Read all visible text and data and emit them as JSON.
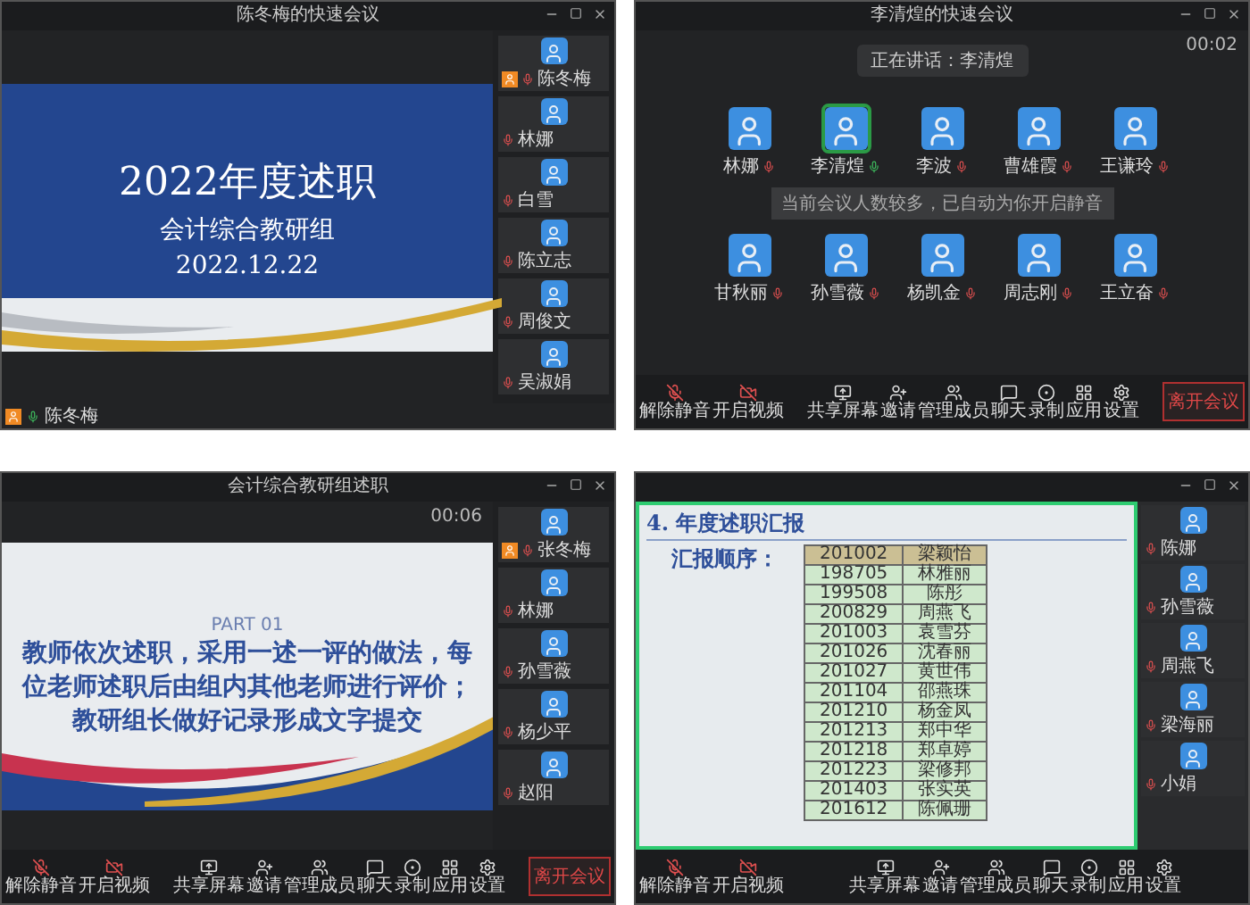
{
  "meetings": [
    {
      "kind": "slide",
      "title": "陈冬梅的快速会议",
      "slide": {
        "title": "2022年度述职",
        "subtitle": "会计综合教研组",
        "date": "2022.12.22"
      },
      "participants": [
        {
          "name": "陈冬梅",
          "host": true
        },
        {
          "name": "林娜",
          "host": false
        },
        {
          "name": "白雪",
          "host": false
        },
        {
          "name": "陈立志",
          "host": false
        },
        {
          "name": "周俊文",
          "host": false
        },
        {
          "name": "吴淑娟",
          "host": false
        }
      ],
      "speaker": "陈冬梅"
    },
    {
      "kind": "grid",
      "title": "李清煌的快速会议",
      "timer": "00:02",
      "notice": "正在讲话：李清煌",
      "tooltip": "当前会议人数较多，已自动为你开启静音",
      "people": [
        {
          "name": "林娜",
          "speaking": false
        },
        {
          "name": "李清煌",
          "speaking": true
        },
        {
          "name": "李波",
          "speaking": false
        },
        {
          "name": "曹雄霞",
          "speaking": false
        },
        {
          "name": "王谦玲",
          "speaking": false
        },
        {
          "name": "甘秋丽",
          "speaking": false
        },
        {
          "name": "孙雪薇",
          "speaking": false
        },
        {
          "name": "杨凯金",
          "speaking": false
        },
        {
          "name": "周志刚",
          "speaking": false
        },
        {
          "name": "王立奋",
          "speaking": false
        }
      ],
      "toolbar": [
        {
          "kind": "mic",
          "label": "解除静音"
        },
        {
          "kind": "video",
          "label": "开启视频"
        },
        {
          "kind": "share",
          "label": "共享屏幕"
        },
        {
          "kind": "invite",
          "label": "邀请"
        },
        {
          "kind": "members",
          "label": "管理成员"
        },
        {
          "kind": "chat",
          "label": "聊天"
        },
        {
          "kind": "record",
          "label": "录制"
        },
        {
          "kind": "apps",
          "label": "应用"
        },
        {
          "kind": "settings",
          "label": "设置"
        }
      ],
      "leave": "离开会议"
    },
    {
      "kind": "text_slide",
      "title": "会计综合教研组述职",
      "timer": "00:06",
      "slide": {
        "part": "PART 01",
        "lines": [
          "教师依次述职，采用一述一评的做法，每",
          "位老师述职后由组内其他老师进行评价；",
          "教研组长做好记录形成文字提交"
        ]
      },
      "participants": [
        {
          "name": "张冬梅",
          "host": true
        },
        {
          "name": "林娜",
          "host": false
        },
        {
          "name": "孙雪薇",
          "host": false
        },
        {
          "name": "杨少平",
          "host": false
        },
        {
          "name": "赵阳",
          "host": false
        }
      ],
      "toolbar": [
        {
          "kind": "mic",
          "label": "解除静音"
        },
        {
          "kind": "video",
          "label": "开启视频"
        },
        {
          "kind": "share",
          "label": "共享屏幕"
        },
        {
          "kind": "invite",
          "label": "邀请"
        },
        {
          "kind": "members",
          "label": "管理成员"
        },
        {
          "kind": "chat",
          "label": "聊天"
        },
        {
          "kind": "record",
          "label": "录制"
        },
        {
          "kind": "apps",
          "label": "应用"
        },
        {
          "kind": "settings",
          "label": "设置"
        }
      ],
      "leave": "离开会议"
    },
    {
      "kind": "table_slide",
      "slide": {
        "title": "4. 年度述职汇报",
        "label": "汇报顺序：",
        "rows": [
          [
            "201002",
            "梁颖怡"
          ],
          [
            "198705",
            "林雅丽"
          ],
          [
            "199508",
            "陈彤"
          ],
          [
            "200829",
            "周燕飞"
          ],
          [
            "201003",
            "袁雪芬"
          ],
          [
            "201026",
            "沈春丽"
          ],
          [
            "201027",
            "黄世伟"
          ],
          [
            "201104",
            "邵燕珠"
          ],
          [
            "201210",
            "杨金凤"
          ],
          [
            "201213",
            "郑中华"
          ],
          [
            "201218",
            "郑卓婷"
          ],
          [
            "201223",
            "梁修邦"
          ],
          [
            "201403",
            "张实英"
          ],
          [
            "201612",
            "陈佩珊"
          ]
        ]
      },
      "participants": [
        {
          "name": "陈娜"
        },
        {
          "name": "孙雪薇"
        },
        {
          "name": "周燕飞"
        },
        {
          "name": "梁海丽"
        },
        {
          "name": "小娟"
        }
      ],
      "toolbar": [
        {
          "kind": "mic",
          "label": "解除静音"
        },
        {
          "kind": "video",
          "label": "开启视频"
        },
        {
          "kind": "share",
          "label": "共享屏幕"
        },
        {
          "kind": "invite",
          "label": "邀请"
        },
        {
          "kind": "members",
          "label": "管理成员"
        },
        {
          "kind": "chat",
          "label": "聊天"
        },
        {
          "kind": "record",
          "label": "录制"
        },
        {
          "kind": "apps",
          "label": "应用"
        },
        {
          "kind": "settings",
          "label": "设置"
        }
      ]
    }
  ]
}
